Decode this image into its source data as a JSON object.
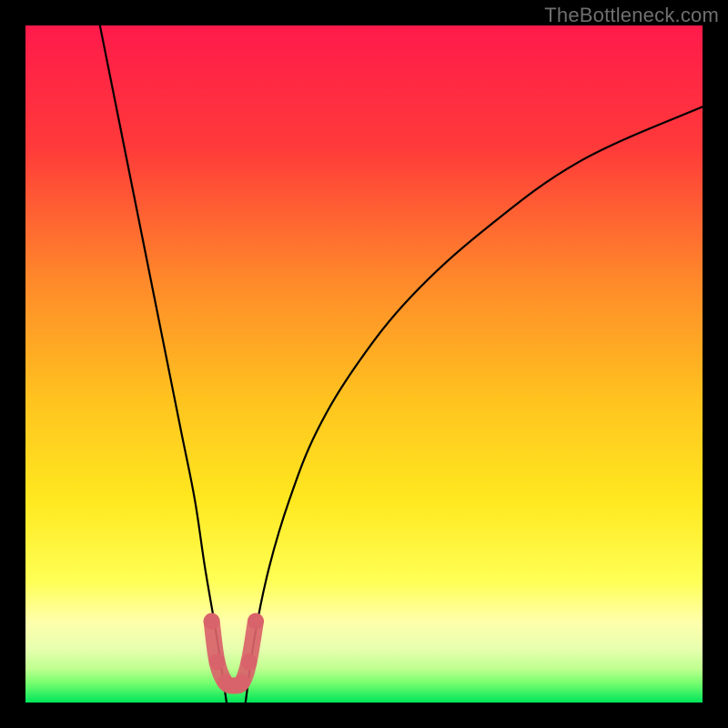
{
  "watermark": "TheBottleneck.com",
  "chart_data": {
    "type": "line",
    "title": "",
    "xlabel": "",
    "ylabel": "",
    "xlim": [
      0,
      100
    ],
    "ylim": [
      0,
      100
    ],
    "grid": false,
    "background_gradient": {
      "top": "#ff1a4b",
      "mid_upper": "#ff7a2f",
      "mid": "#ffd400",
      "mid_lower": "#ffff66",
      "lower": "#e6ffb3",
      "bottom": "#00e55a"
    },
    "series": [
      {
        "name": "left-branch",
        "stroke": "#000000",
        "values": [
          {
            "x": 11,
            "y": 100
          },
          {
            "x": 13,
            "y": 90
          },
          {
            "x": 15,
            "y": 80
          },
          {
            "x": 17,
            "y": 70
          },
          {
            "x": 19,
            "y": 60
          },
          {
            "x": 21,
            "y": 50
          },
          {
            "x": 23,
            "y": 40
          },
          {
            "x": 25,
            "y": 30
          },
          {
            "x": 26.5,
            "y": 20
          },
          {
            "x": 28.2,
            "y": 10
          },
          {
            "x": 29.7,
            "y": 0
          }
        ]
      },
      {
        "name": "right-branch",
        "stroke": "#000000",
        "values": [
          {
            "x": 32.5,
            "y": 0
          },
          {
            "x": 33.9,
            "y": 10
          },
          {
            "x": 36,
            "y": 20
          },
          {
            "x": 39,
            "y": 30
          },
          {
            "x": 43,
            "y": 40
          },
          {
            "x": 49,
            "y": 50
          },
          {
            "x": 57,
            "y": 60
          },
          {
            "x": 68,
            "y": 70
          },
          {
            "x": 82,
            "y": 80
          },
          {
            "x": 100,
            "y": 88
          }
        ]
      },
      {
        "name": "bottom-highlight",
        "stroke": "#d9636a",
        "values": [
          {
            "x": 27.5,
            "y": 12
          },
          {
            "x": 28.3,
            "y": 6
          },
          {
            "x": 29.5,
            "y": 3
          },
          {
            "x": 30.8,
            "y": 2.5
          },
          {
            "x": 32,
            "y": 3
          },
          {
            "x": 33,
            "y": 6
          },
          {
            "x": 34,
            "y": 12
          }
        ]
      }
    ]
  }
}
